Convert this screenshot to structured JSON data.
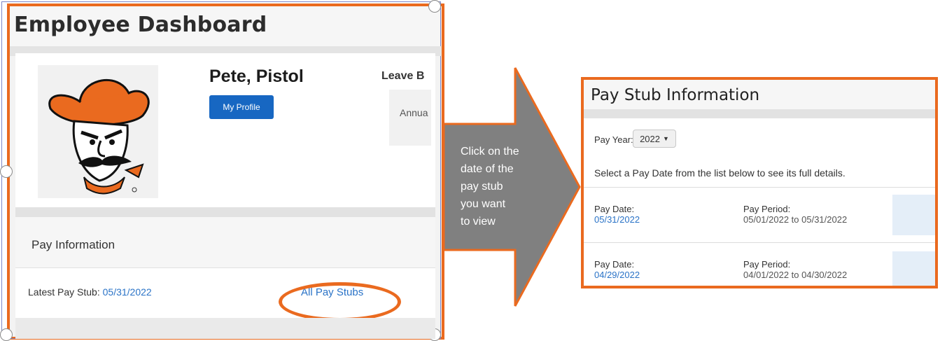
{
  "dashboard": {
    "title": "Employee Dashboard",
    "employee_name": "Pete, Pistol",
    "profile_button": "My Profile",
    "leave_title": "Leave B",
    "leave_item": "Annua",
    "pay_info_title": "Pay Information",
    "latest_label": "Latest Pay Stub:",
    "latest_date": "05/31/2022",
    "all_stubs_link": "All Pay Stubs"
  },
  "callout": {
    "lines": [
      "Click on the",
      "date of the",
      "pay stub",
      "you want",
      "to view"
    ]
  },
  "pay_stub": {
    "title": "Pay Stub Information",
    "year_label": "Pay Year:",
    "year_value": "2022",
    "instruction": "Select a Pay Date from the list below to see its full details.",
    "rows": [
      {
        "date_label": "Pay Date:",
        "date": "05/31/2022",
        "period_label": "Pay Period:",
        "period": "05/01/2022 to 05/31/2022"
      },
      {
        "date_label": "Pay Date:",
        "date": "04/29/2022",
        "period_label": "Pay Period:",
        "period": "04/01/2022 to 04/30/2022"
      }
    ]
  },
  "colors": {
    "highlight_orange": "#ea6a1f",
    "link_blue": "#2a73c7",
    "button_blue": "#1767c2",
    "arrow_gray": "#808080"
  }
}
